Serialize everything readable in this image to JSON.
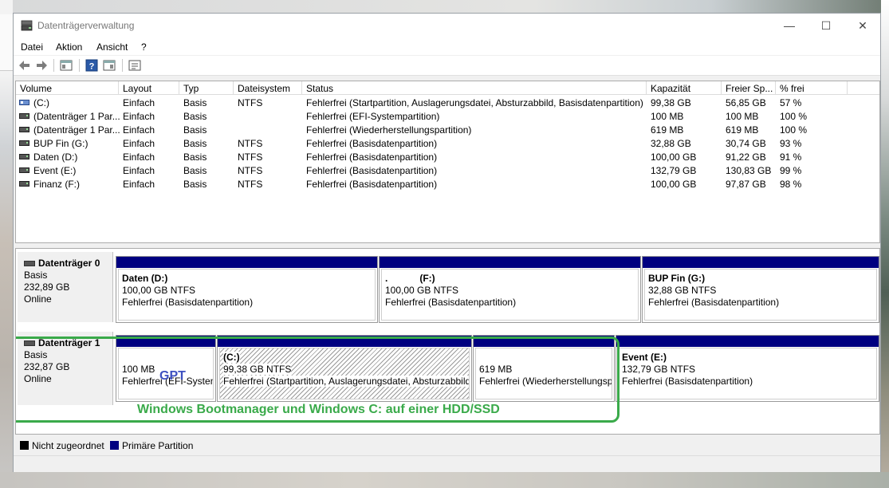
{
  "window": {
    "title": "Datenträgerverwaltung",
    "controls": {
      "minimize": "—",
      "maximize": "☐",
      "close": "✕"
    }
  },
  "menu": [
    "Datei",
    "Aktion",
    "Ansicht",
    "?"
  ],
  "volume_list": {
    "columns": [
      "Volume",
      "Layout",
      "Typ",
      "Dateisystem",
      "Status",
      "Kapazität",
      "Freier Sp...",
      "% frei"
    ],
    "rows": [
      [
        "(C:)",
        "Einfach",
        "Basis",
        "NTFS",
        "Fehlerfrei (Startpartition, Auslagerungsdatei, Absturzabbild, Basisdatenpartition)",
        "99,38 GB",
        "56,85 GB",
        "57 %"
      ],
      [
        "(Datenträger 1 Par...",
        "Einfach",
        "Basis",
        "",
        "Fehlerfrei (EFI-Systempartition)",
        "100 MB",
        "100 MB",
        "100 %"
      ],
      [
        "(Datenträger 1 Par...",
        "Einfach",
        "Basis",
        "",
        "Fehlerfrei (Wiederherstellungspartition)",
        "619 MB",
        "619 MB",
        "100 %"
      ],
      [
        "BUP Fin (G:)",
        "Einfach",
        "Basis",
        "NTFS",
        "Fehlerfrei (Basisdatenpartition)",
        "32,88 GB",
        "30,74 GB",
        "93 %"
      ],
      [
        "Daten (D:)",
        "Einfach",
        "Basis",
        "NTFS",
        "Fehlerfrei (Basisdatenpartition)",
        "100,00 GB",
        "91,22 GB",
        "91 %"
      ],
      [
        "Event (E:)",
        "Einfach",
        "Basis",
        "NTFS",
        "Fehlerfrei (Basisdatenpartition)",
        "132,79 GB",
        "130,83 GB",
        "99 %"
      ],
      [
        "Finanz (F:)",
        "Einfach",
        "Basis",
        "NTFS",
        "Fehlerfrei (Basisdatenpartition)",
        "100,00 GB",
        "97,87 GB",
        "98 %"
      ]
    ]
  },
  "disks": [
    {
      "name": "Datenträger 0",
      "type": "Basis",
      "size": "232,89 GB",
      "state": "Online",
      "partitions": [
        {
          "name": "Daten  (D:)",
          "size": "100,00 GB NTFS",
          "status": "Fehlerfrei (Basisdatenpartition)"
        },
        {
          "name": ".            (F:)",
          "size": "100,00 GB NTFS",
          "status": "Fehlerfrei (Basisdatenpartition)"
        },
        {
          "name": "BUP Fin  (G:)",
          "size": "32,88 GB NTFS",
          "status": "Fehlerfrei (Basisdatenpartition)"
        }
      ]
    },
    {
      "name": "Datenträger 1",
      "type": "Basis",
      "size": "232,87 GB",
      "state": "Online",
      "partitions": [
        {
          "name": "",
          "size": "100 MB",
          "status": "Fehlerfrei (EFI-Systempartition)"
        },
        {
          "name": "(C:)",
          "size": "99,38 GB NTFS",
          "status": "Fehlerfrei (Startpartition, Auslagerungsdatei, Absturzabbild, Basisdatenpartition)"
        },
        {
          "name": "",
          "size": "619 MB",
          "status": "Fehlerfrei (Wiederherstellungspartition)"
        },
        {
          "name": "Event  (E:)",
          "size": "132,79 GB NTFS",
          "status": "Fehlerfrei (Basisdatenpartition)"
        }
      ]
    }
  ],
  "annotations": {
    "gpt": "GPT",
    "caption": "Windows Bootmanager und Windows C: auf einer HDD/SSD"
  },
  "legend": {
    "unallocated": "Nicht zugeordnet",
    "primary": "Primäre Partition"
  },
  "colors": {
    "partition_bar": "#000080",
    "annotation_green": "#3aaa4a",
    "annotation_blue": "#3d50c0"
  }
}
